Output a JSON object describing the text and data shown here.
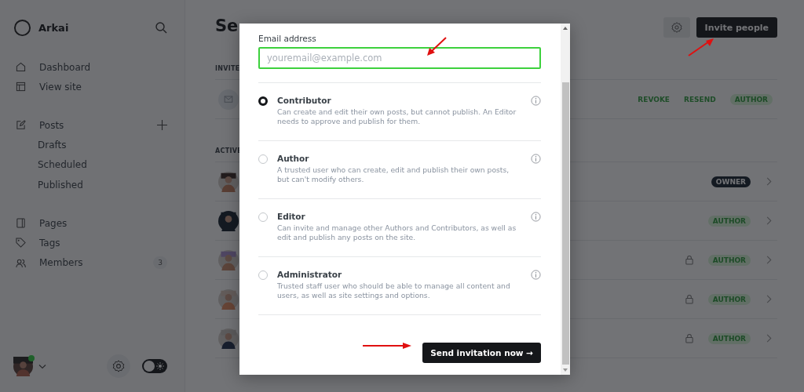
{
  "sidebar": {
    "brand": "Arkai",
    "nav_top": [
      {
        "label": "Dashboard"
      },
      {
        "label": "View site"
      }
    ],
    "posts": {
      "label": "Posts",
      "children": [
        {
          "label": "Drafts"
        },
        {
          "label": "Scheduled"
        },
        {
          "label": "Published"
        }
      ]
    },
    "nav_bottom": [
      {
        "label": "Pages"
      },
      {
        "label": "Tags"
      },
      {
        "label": "Members",
        "count": "3"
      }
    ],
    "user": {
      "online": true
    },
    "dark_mode": false
  },
  "main": {
    "title": "Se",
    "invite_button": "Invite people",
    "invited": {
      "heading": "INVITE",
      "rows": [
        {
          "actions": [
            "REVOKE",
            "RESEND"
          ],
          "role": "AUTHOR",
          "kind": "author"
        }
      ]
    },
    "active": {
      "heading": "ACTIVE",
      "rows": [
        {
          "role": "OWNER",
          "kind": "owner",
          "locked": false
        },
        {
          "role": "AUTHOR",
          "kind": "author",
          "locked": false
        },
        {
          "role": "AUTHOR",
          "kind": "author",
          "locked": true
        },
        {
          "role": "AUTHOR",
          "kind": "author",
          "locked": true
        },
        {
          "role": "AUTHOR",
          "kind": "author",
          "locked": true
        }
      ]
    }
  },
  "modal": {
    "email_label": "Email address",
    "email_placeholder": "youremail@example.com",
    "email_focused": true,
    "roles": [
      {
        "name": "Contributor",
        "description": "Can create and edit their own posts, but cannot publish. An Editor needs to approve and publish for them.",
        "selected": true
      },
      {
        "name": "Author",
        "description": "A trusted user who can create, edit and publish their own posts, but can't modify others.",
        "selected": false
      },
      {
        "name": "Editor",
        "description": "Can invite and manage other Authors and Contributors, as well as edit and publish any posts on the site.",
        "selected": false
      },
      {
        "name": "Administrator",
        "description": "Trusted staff user who should be able to manage all content and users, as well as site settings and options.",
        "selected": false
      }
    ],
    "send_button": "Send invitation now →"
  }
}
